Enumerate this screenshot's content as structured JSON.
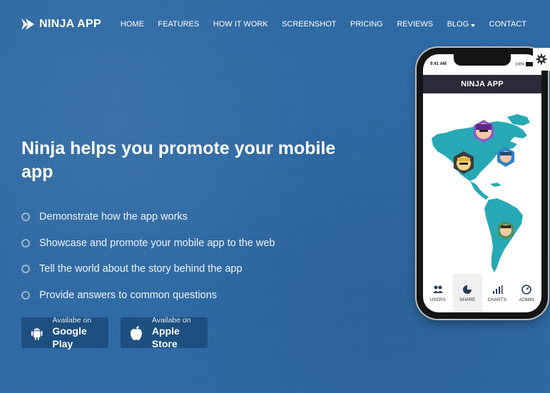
{
  "brand": {
    "name": "NINJA APP",
    "logo_icon": "ninja-arrow-logo"
  },
  "nav": {
    "items": [
      {
        "label": "HOME"
      },
      {
        "label": "FEATURES"
      },
      {
        "label": "HOW IT WORK"
      },
      {
        "label": "SCREENSHOT"
      },
      {
        "label": "PRICING"
      },
      {
        "label": "REVIEWS"
      },
      {
        "label": "BLOG",
        "has_dropdown": true
      },
      {
        "label": "CONTACT"
      }
    ]
  },
  "hero": {
    "title": "Ninja helps you promote your mobile app",
    "features": [
      "Demonstrate how the app works",
      "Showcase and promote your mobile app to the web",
      "Tell the world about the story behind the app",
      "Provide answers to common questions"
    ]
  },
  "stores": {
    "google": {
      "small": "Availabe on",
      "big": "Google Play",
      "icon": "android-icon"
    },
    "apple": {
      "small": "Availabe on",
      "big": "Apple Store",
      "icon": "apple-icon"
    }
  },
  "phone": {
    "time": "9:41 AM",
    "battery": "100%",
    "app_title": "NINJA APP",
    "tabs": [
      {
        "label": "USERS",
        "icon": "users-icon"
      },
      {
        "label": "SHARE",
        "icon": "pie-chart-icon",
        "active": true
      },
      {
        "label": "CHARTS",
        "icon": "bar-chart-icon"
      },
      {
        "label": "ADMIN",
        "icon": "gauge-icon"
      }
    ]
  },
  "settings": {
    "icon": "gear-icon"
  },
  "colors": {
    "background": "#2d6aa6",
    "button": "#1d4f80",
    "map": "#27a9b5",
    "app_bar": "#2b2a38"
  }
}
